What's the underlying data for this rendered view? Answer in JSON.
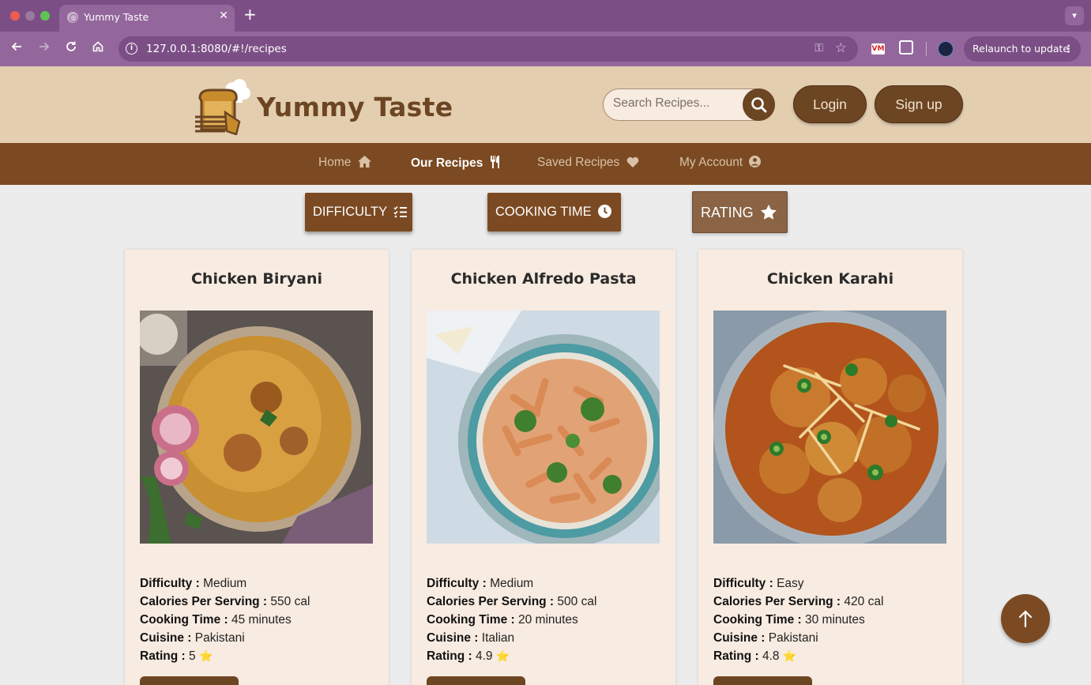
{
  "browser": {
    "tab_title": "Yummy Taste",
    "url": "127.0.0.1:8080/#!/recipes",
    "relaunch_label": "Relaunch to update",
    "ext_label": "VM"
  },
  "site": {
    "logo_text": "Yummy Taste",
    "search_placeholder": "Search Recipes...",
    "login_label": "Login",
    "signup_label": "Sign up"
  },
  "nav": {
    "home": "Home",
    "recipes": "Our Recipes",
    "saved": "Saved Recipes",
    "account": "My Account",
    "active": "recipes"
  },
  "filters": {
    "difficulty": "DIFFICULTY",
    "cooking_time": "COOKING TIME",
    "rating": "RATING"
  },
  "labels": {
    "difficulty": "Difficulty :",
    "calories": "Calories Per Serving :",
    "cooking_time": "Cooking Time :",
    "cuisine": "Cuisine :",
    "rating": "Rating :",
    "star": "⭐"
  },
  "recipes": [
    {
      "name": "Chicken Biryani",
      "difficulty": "Medium",
      "calories": "550 cal",
      "cooking_time": "45 minutes",
      "cuisine": "Pakistani",
      "rating": "5"
    },
    {
      "name": "Chicken Alfredo Pasta",
      "difficulty": "Medium",
      "calories": "500 cal",
      "cooking_time": "20 minutes",
      "cuisine": "Italian",
      "rating": "4.9"
    },
    {
      "name": "Chicken Karahi",
      "difficulty": "Easy",
      "calories": "420 cal",
      "cooking_time": "30 minutes",
      "cuisine": "Pakistani",
      "rating": "4.8"
    }
  ],
  "colors": {
    "brown_primary": "#7b4a22",
    "header_bg": "#e3ceb0",
    "card_bg": "#f8ebe1",
    "browser_chrome": "#7b4f85"
  }
}
